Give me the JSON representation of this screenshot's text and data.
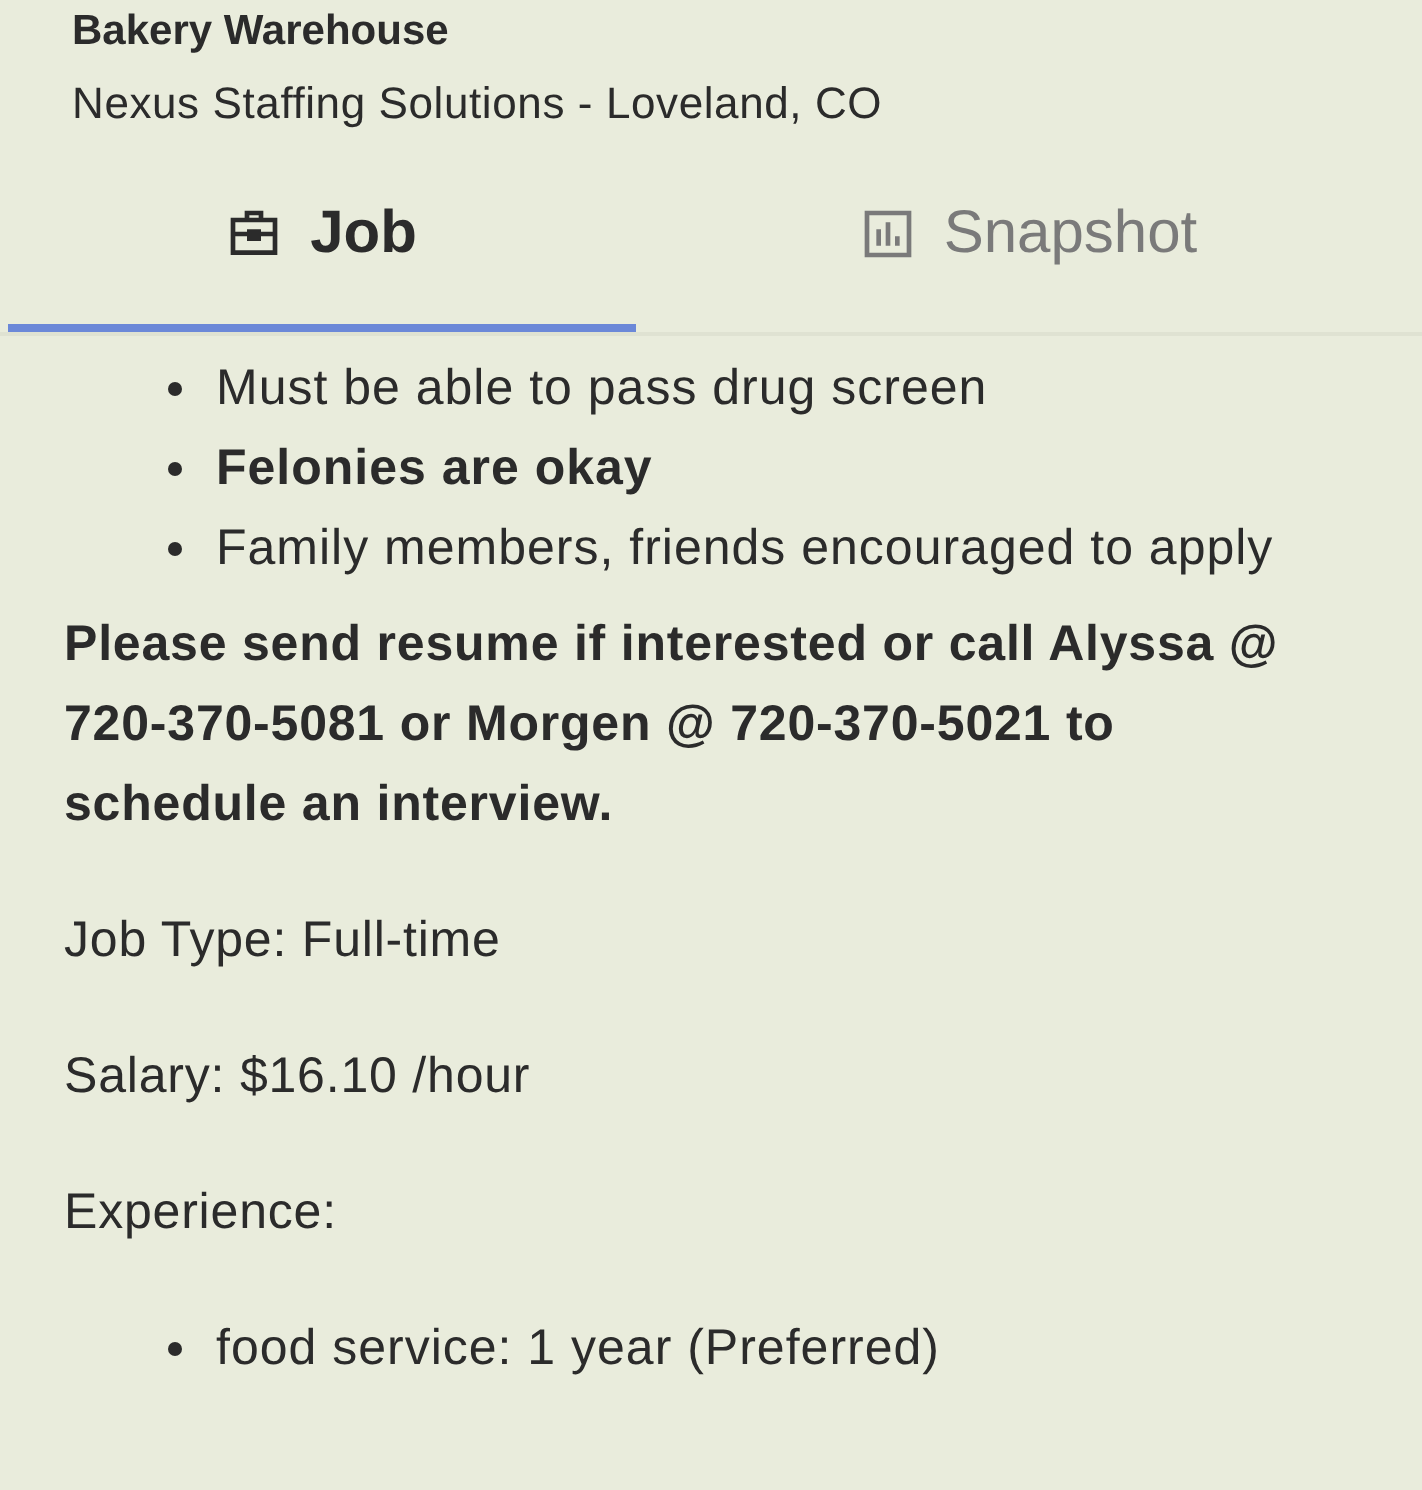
{
  "header": {
    "title": "Bakery Warehouse",
    "subtitle": "Nexus Staffing Solutions - Loveland, CO"
  },
  "tabs": [
    {
      "label": "Job",
      "kind": "briefcase",
      "selected": true
    },
    {
      "label": "Snapshot",
      "kind": "chart",
      "selected": false
    }
  ],
  "content": [
    {
      "kind": "list",
      "items": [
        {
          "text": "Must be able to pass drug screen",
          "bold": false
        },
        {
          "text": "Felonies are okay",
          "bold": true
        },
        {
          "text": "Family members, friends encouraged to apply",
          "bold": false
        }
      ]
    },
    {
      "kind": "paragraph",
      "text": "Please send resume if interested or call Alyssa @ 720-370-5081 or Morgen @ 720-370-5021 to schedule an interview.",
      "bold": true
    },
    {
      "kind": "paragraph",
      "text": "Job Type: Full-time",
      "bold": false
    },
    {
      "kind": "paragraph",
      "text": "Salary: $16.10 /hour",
      "bold": false
    },
    {
      "kind": "paragraph",
      "text": "Experience:",
      "bold": false
    },
    {
      "kind": "list",
      "items": [
        {
          "text": "food service: 1 year (Preferred)",
          "bold": false
        }
      ]
    }
  ]
}
